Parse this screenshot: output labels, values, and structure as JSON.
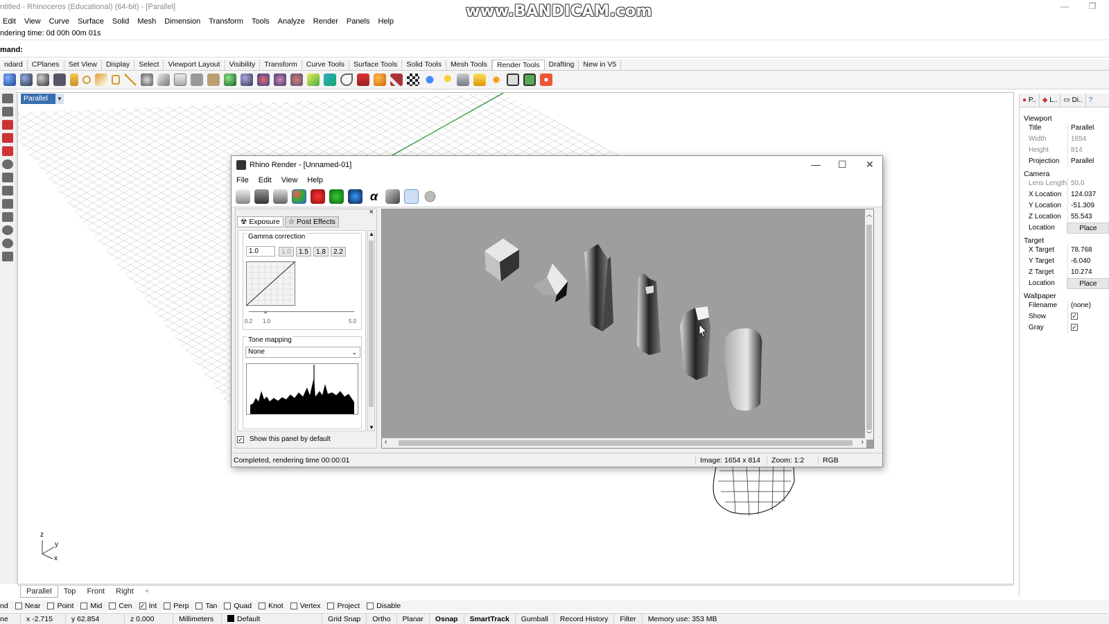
{
  "app": {
    "title": "ntitled - Rhinoceros (Educational) (64-bit) - [Parallel]",
    "watermark": "www.BANDICAM.com"
  },
  "menu": [
    "Edit",
    "View",
    "Curve",
    "Surface",
    "Solid",
    "Mesh",
    "Dimension",
    "Transform",
    "Tools",
    "Analyze",
    "Render",
    "Panels",
    "Help"
  ],
  "command_history": "ndering time: 0d 00h 00m 01s",
  "command_prompt": "mand:",
  "toolbar_tabs": [
    "ndard",
    "CPlanes",
    "Set View",
    "Display",
    "Select",
    "Viewport Layout",
    "Visibility",
    "Transform",
    "Curve Tools",
    "Surface Tools",
    "Solid Tools",
    "Mesh Tools",
    "Render Tools",
    "Drafting",
    "New in V5"
  ],
  "toolbar_active": "Render Tools",
  "viewport": {
    "label": "Parallel",
    "tabs": [
      "Parallel",
      "Top",
      "Front",
      "Right"
    ],
    "add_tab": "+",
    "axis": {
      "z": "z",
      "y": "y",
      "x": "x"
    }
  },
  "render_window": {
    "title": "Rhino Render - [Unnamed-01]",
    "menu": [
      "File",
      "Edit",
      "View",
      "Help"
    ],
    "panel_tabs": [
      "Exposure",
      "Post Effects"
    ],
    "gamma": {
      "label": "Gamma correction",
      "value": "1.0",
      "presets": [
        "1.0",
        "1.5",
        "1.8",
        "2.2"
      ],
      "slider_min": "0.2",
      "slider_val": "1.0",
      "slider_max": "5.0"
    },
    "tone_mapping": {
      "label": "Tone mapping",
      "value": "None"
    },
    "show_panel": "Show this panel by default",
    "status": "Completed, rendering time 00:00:01",
    "image_size": "Image: 1654 x 814",
    "zoom": "Zoom: 1:2",
    "mode": "RGB"
  },
  "right_panel": {
    "tabs": [
      "P..",
      "L..",
      "Di.."
    ],
    "sections": {
      "viewport": "Viewport",
      "camera": "Camera",
      "target": "Target",
      "wallpaper": "Wallpaper"
    },
    "viewport_props": [
      [
        "Title",
        "Parallel"
      ],
      [
        "Width",
        "1654"
      ],
      [
        "Height",
        "814"
      ],
      [
        "Projection",
        "Parallel"
      ]
    ],
    "camera_props": [
      [
        "Lens Length",
        "50.0"
      ],
      [
        "X Location",
        "124.037"
      ],
      [
        "Y Location",
        "-51.309"
      ],
      [
        "Z Location",
        "55.543"
      ],
      [
        "Location",
        "Place"
      ]
    ],
    "target_props": [
      [
        "X Target",
        "78.768"
      ],
      [
        "Y Target",
        "-6.040"
      ],
      [
        "Z Target",
        "10.274"
      ],
      [
        "Location",
        "Place"
      ]
    ],
    "wallpaper_props": [
      [
        "Filename",
        "(none)"
      ],
      [
        "Show",
        ""
      ],
      [
        "Gray",
        ""
      ]
    ]
  },
  "osnaps": [
    [
      "nd",
      false
    ],
    [
      "Near",
      false
    ],
    [
      "Point",
      false
    ],
    [
      "Mid",
      false
    ],
    [
      "Cen",
      true
    ],
    [
      "Int",
      false
    ],
    [
      "Perp",
      false
    ],
    [
      "Tan",
      false
    ],
    [
      "Quad",
      false
    ],
    [
      "Knot",
      false
    ],
    [
      "Vertex",
      false
    ],
    [
      "Project",
      false
    ],
    [
      "Disable",
      false
    ]
  ],
  "status": {
    "cplane": "ne",
    "x": "x -2.715",
    "y": "y 62.854",
    "z": "z 0.000",
    "units": "Millimeters",
    "layer": "Default",
    "grid_snap": "Grid Snap",
    "ortho": "Ortho",
    "planar": "Planar",
    "osnap": "Osnap",
    "smarttrack": "SmartTrack",
    "gumball": "Gumball",
    "record_history": "Record History",
    "filter": "Filter",
    "memory": "Memory use: 353 MB"
  }
}
